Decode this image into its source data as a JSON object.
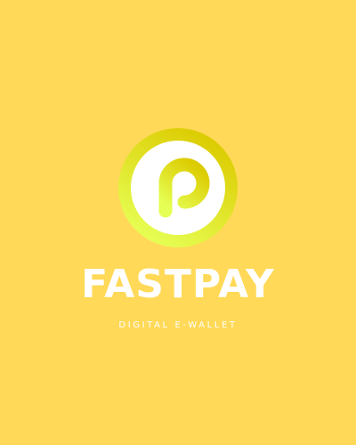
{
  "app": {
    "name": "FASTPAY",
    "tagline": "DIGITAL E-WALLET"
  },
  "logo": {
    "icon": "letter-p-logo-icon",
    "ring_gradient": [
      "#DCCB00",
      "#E6FF55"
    ],
    "inner_color": "#FFFFFF"
  },
  "colors": {
    "background": "#FFD957",
    "text": "#FFFFFF"
  }
}
